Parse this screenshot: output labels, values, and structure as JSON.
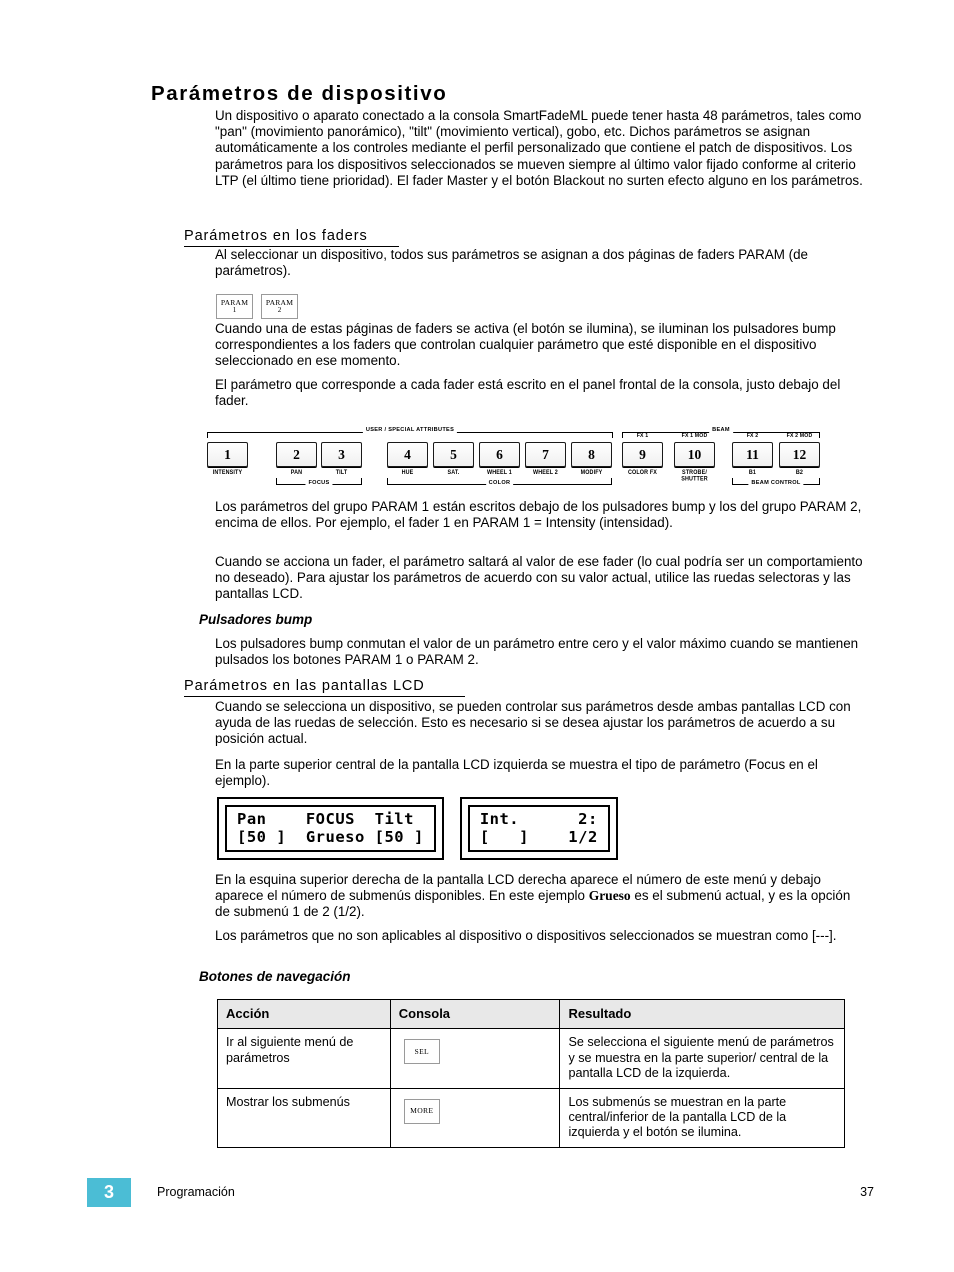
{
  "document": {
    "title": "Parámetros de dispositivo",
    "intro": "Un dispositivo o aparato conectado a la consola SmartFadeML puede tener hasta 48 parámetros, tales como \"pan\" (movimiento panorámico), \"tilt\" (movimiento vertical), gobo, etc. Dichos parámetros se asignan automáticamente a los controles mediante el perfil personalizado que contiene el patch de dispositivos. Los parámetros para los dispositivos seleccionados se mueven siempre al último valor fijado conforme al criterio LTP (el último tiene prioridad). El fader Master y el botón Blackout no surten efecto alguno en los parámetros."
  },
  "section_faders": {
    "heading": "Parámetros en los faders",
    "p1": "Al seleccionar un dispositivo, todos sus parámetros se asignan a dos páginas de faders PARAM (de parámetros).",
    "p2": "Cuando una de estas páginas de faders se activa (el botón se ilumina), se iluminan los pulsadores bump correspondientes a los faders que controlan cualquier parámetro que esté disponible en el dispositivo seleccionado en ese momento.",
    "p3": "El parámetro que corresponde a cada fader está escrito en el panel frontal de la consola, justo debajo del fader.",
    "p4": "Los parámetros del grupo PARAM 1 están escritos debajo de los pulsadores bump y los del grupo PARAM 2, encima de ellos. Por ejemplo, el fader 1 en PARAM 1 = Intensity (intensidad).",
    "p5": "Cuando se acciona un fader, el parámetro saltará al valor de ese fader (lo cual podría ser un comportamiento no deseado). Para ajustar los parámetros de acuerdo con su valor actual, utilice las ruedas selectoras y las pantallas LCD.",
    "param_buttons": [
      {
        "line1": "PARAM",
        "line2": "1"
      },
      {
        "line1": "PARAM",
        "line2": "2"
      }
    ]
  },
  "console_diagram": {
    "faders": [
      {
        "number": "1",
        "below": "INTENSITY",
        "above": ""
      },
      {
        "number": "2",
        "below": "PAN",
        "above": ""
      },
      {
        "number": "3",
        "below": "TILT",
        "above": ""
      },
      {
        "number": "4",
        "below": "HUE",
        "above": ""
      },
      {
        "number": "5",
        "below": "SAT.",
        "above": ""
      },
      {
        "number": "6",
        "below": "WHEEL 1",
        "above": ""
      },
      {
        "number": "7",
        "below": "WHEEL 2",
        "above": ""
      },
      {
        "number": "8",
        "below": "MODIFY",
        "above": ""
      },
      {
        "number": "9",
        "below": "COLOR FX",
        "above": "FX 1"
      },
      {
        "number": "10",
        "below": "STROBE/\nSHUTTER",
        "above": "FX 1 MOD"
      },
      {
        "number": "11",
        "below": "B1",
        "above": "FX 2"
      },
      {
        "number": "12",
        "below": "B2",
        "above": "FX 2 MOD"
      }
    ],
    "groups_top": [
      {
        "label": "USER / SPECIAL ATTRIBUTES"
      },
      {
        "label": "BEAM"
      }
    ],
    "groups_bottom": [
      {
        "label": "FOCUS"
      },
      {
        "label": "COLOR"
      },
      {
        "label": "BEAM CONTROL"
      }
    ]
  },
  "section_bump": {
    "heading": "Pulsadores bump",
    "p1": "Los pulsadores bump conmutan el valor de un parámetro entre cero y el valor máximo cuando se mantienen pulsados los botones PARAM 1 o PARAM 2."
  },
  "section_lcd": {
    "heading": "Parámetros en las pantallas LCD",
    "p1": "Cuando se selecciona un dispositivo, se pueden controlar sus parámetros desde ambas pantallas LCD con ayuda de las ruedas de selección. Esto es necesario si se desea ajustar los parámetros de acuerdo a su posición actual.",
    "p2": "En la parte superior central de la pantalla LCD izquierda se muestra el tipo de parámetro (Focus en el ejemplo).",
    "p3_a": "En la esquina superior derecha de la pantalla LCD derecha aparece el número de este menú y debajo aparece el número de submenús disponibles. En este ejemplo ",
    "p3_b": "Grueso",
    "p3_c": " es el submenú actual, y es la opción de submenú 1 de 2 (1/2).",
    "p4": "Los parámetros que no son aplicables al dispositivo o dispositivos seleccionados se muestran como [---].",
    "lcd_left": {
      "line1": "Pan    FOCUS  Tilt",
      "line2": "[50 ]  Grueso [50 ]"
    },
    "lcd_right": {
      "line1": "Int.      2:",
      "line2": "[   ]    1/2"
    }
  },
  "section_nav": {
    "heading": "Botones de navegación",
    "table": {
      "headers": [
        "Acción",
        "Consola",
        "Resultado"
      ],
      "rows": [
        {
          "action": "Ir al siguiente menú de parámetros",
          "console_button": "SEL",
          "result": "Se selecciona el siguiente menú de parámetros y se muestra en la parte superior/ central de la pantalla LCD de la izquierda."
        },
        {
          "action": "Mostrar los submenús",
          "console_button": "MORE",
          "result": "Los submenús se muestran en la parte central/inferior de la pantalla LCD de la izquierda y el botón se ilumina."
        }
      ]
    }
  },
  "footer": {
    "chapter": "3",
    "title": "Programación",
    "page": "37",
    "chapter_color": "#4BBDD5"
  }
}
